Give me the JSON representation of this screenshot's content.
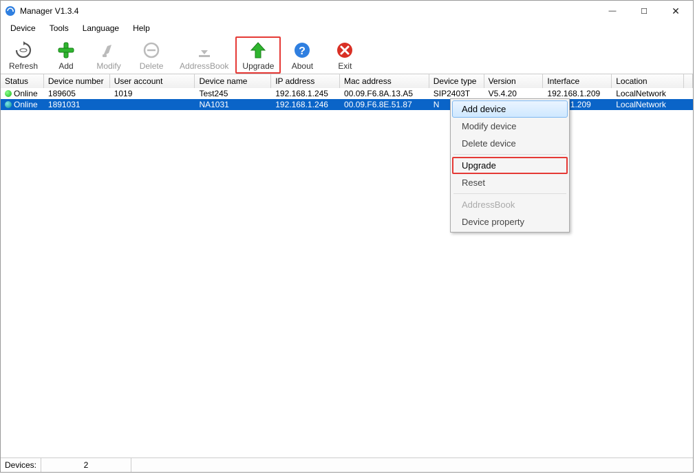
{
  "window": {
    "title": "Manager V1.3.4"
  },
  "menus": [
    "Device",
    "Tools",
    "Language",
    "Help"
  ],
  "toolbar": {
    "refresh": "Refresh",
    "add": "Add",
    "modify": "Modify",
    "delete": "Delete",
    "addressbook": "AddressBook",
    "upgrade": "Upgrade",
    "about": "About",
    "exit": "Exit"
  },
  "columns": {
    "status": "Status",
    "devnum": "Device number",
    "user": "User account",
    "devname": "Device name",
    "ip": "IP address",
    "mac": "Mac address",
    "dtype": "Device type",
    "ver": "Version",
    "iface": "Interface",
    "loc": "Location"
  },
  "rows": [
    {
      "status": "Online",
      "devnum": "189605",
      "user": "1019",
      "devname": "Test245",
      "ip": "192.168.1.245",
      "mac": "00.09.F6.8A.13.A5",
      "dtype": "SIP2403T",
      "ver": "V5.4.20",
      "iface": "192.168.1.209",
      "loc": "LocalNetwork"
    },
    {
      "status": "Online",
      "devnum": "1891031",
      "user": "",
      "devname": "NA1031",
      "ip": "192.168.1.246",
      "mac": "00.09.F6.8E.51.87",
      "dtype": "N",
      "ver": "",
      "iface": "2.168.1.209",
      "loc": "LocalNetwork"
    }
  ],
  "context_menu": {
    "add": "Add device",
    "modify": "Modify device",
    "delete": "Delete device",
    "upgrade": "Upgrade",
    "reset": "Reset",
    "addressbook": "AddressBook",
    "property": "Device property"
  },
  "statusbar": {
    "label": "Devices:",
    "count": "2"
  }
}
